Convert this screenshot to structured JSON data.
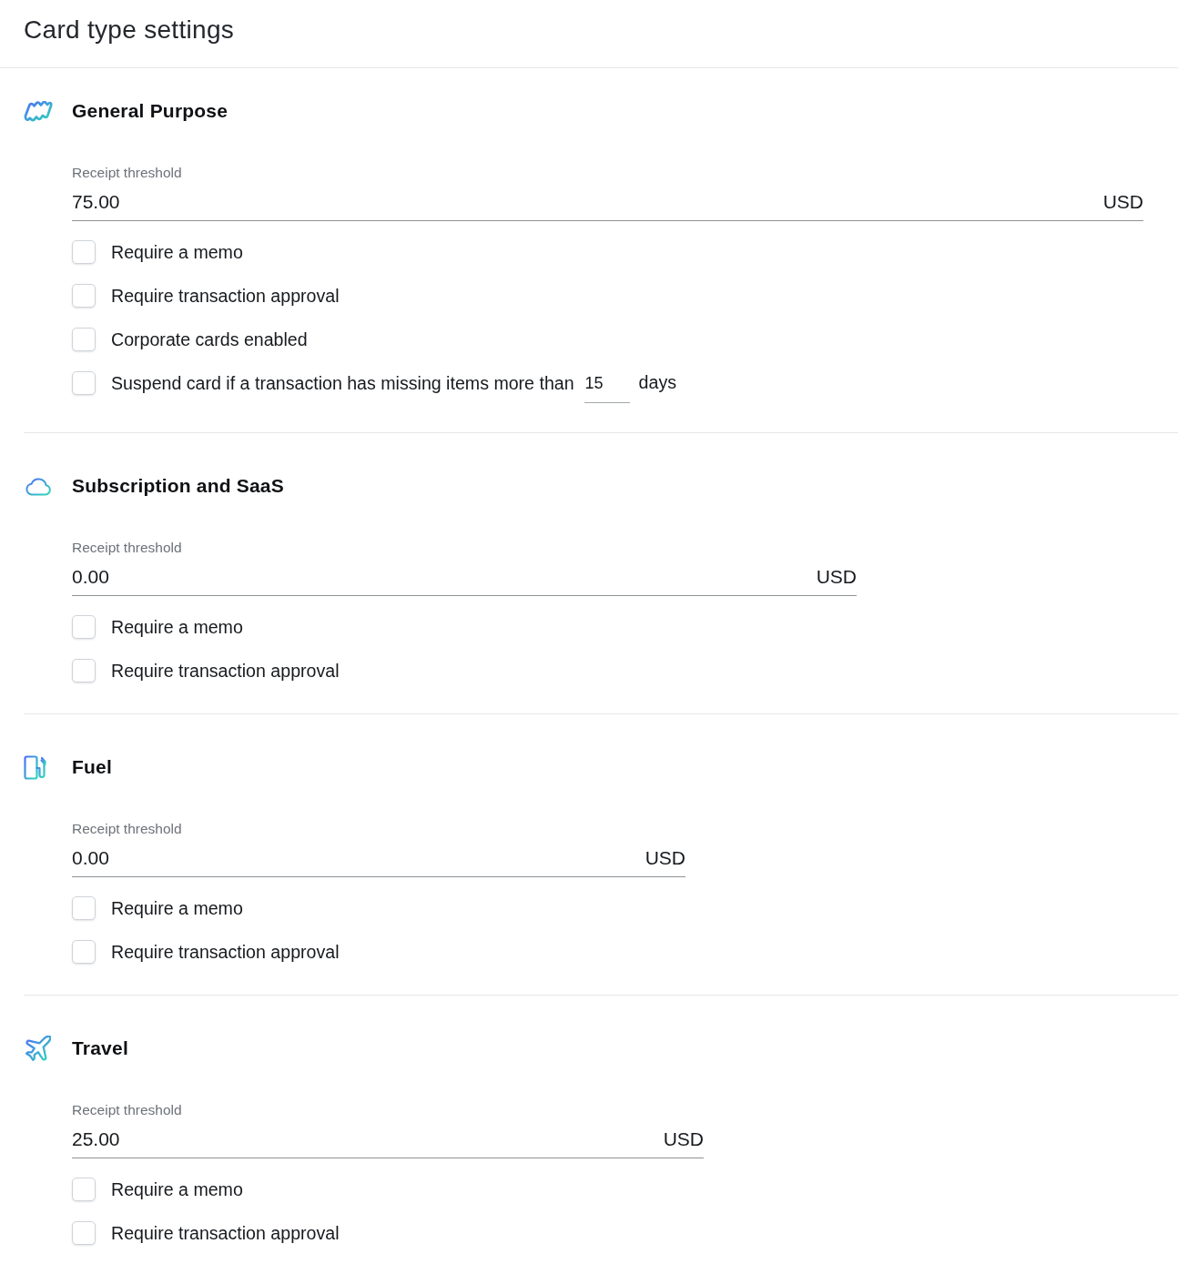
{
  "page": {
    "title": "Card type settings"
  },
  "card_types": [
    {
      "kind": "general_purpose",
      "name": "General Purpose",
      "receipt_threshold": {
        "label": "Receipt threshold",
        "value": "75.00",
        "currency": "USD"
      },
      "options": [
        {
          "kind": "checkbox",
          "label": "Require a memo",
          "checked": false
        },
        {
          "kind": "checkbox",
          "label": "Require transaction approval",
          "checked": false
        },
        {
          "kind": "checkbox",
          "label": "Corporate cards enabled",
          "checked": false
        },
        {
          "kind": "suspend",
          "label": "Suspend card if a transaction has missing items more than",
          "value": "15",
          "unit": "days",
          "checked": false
        }
      ]
    },
    {
      "kind": "subscription",
      "name": "Subscription and SaaS",
      "receipt_threshold": {
        "label": "Receipt threshold",
        "value": "0.00",
        "currency": "USD"
      },
      "options": [
        {
          "kind": "checkbox",
          "label": "Require a memo",
          "checked": false
        },
        {
          "kind": "checkbox",
          "label": "Require transaction approval",
          "checked": false
        }
      ]
    },
    {
      "kind": "fuel",
      "name": "Fuel",
      "receipt_threshold": {
        "label": "Receipt threshold",
        "value": "0.00",
        "currency": "USD"
      },
      "options": [
        {
          "kind": "checkbox",
          "label": "Require a memo",
          "checked": false
        },
        {
          "kind": "checkbox",
          "label": "Require transaction approval",
          "checked": false
        }
      ]
    },
    {
      "kind": "travel",
      "name": "Travel",
      "receipt_threshold": {
        "label": "Receipt threshold",
        "value": "25.00",
        "currency": "USD"
      },
      "options": [
        {
          "kind": "checkbox",
          "label": "Require a memo",
          "checked": false
        },
        {
          "kind": "checkbox",
          "label": "Require transaction approval",
          "checked": false
        }
      ]
    }
  ]
}
